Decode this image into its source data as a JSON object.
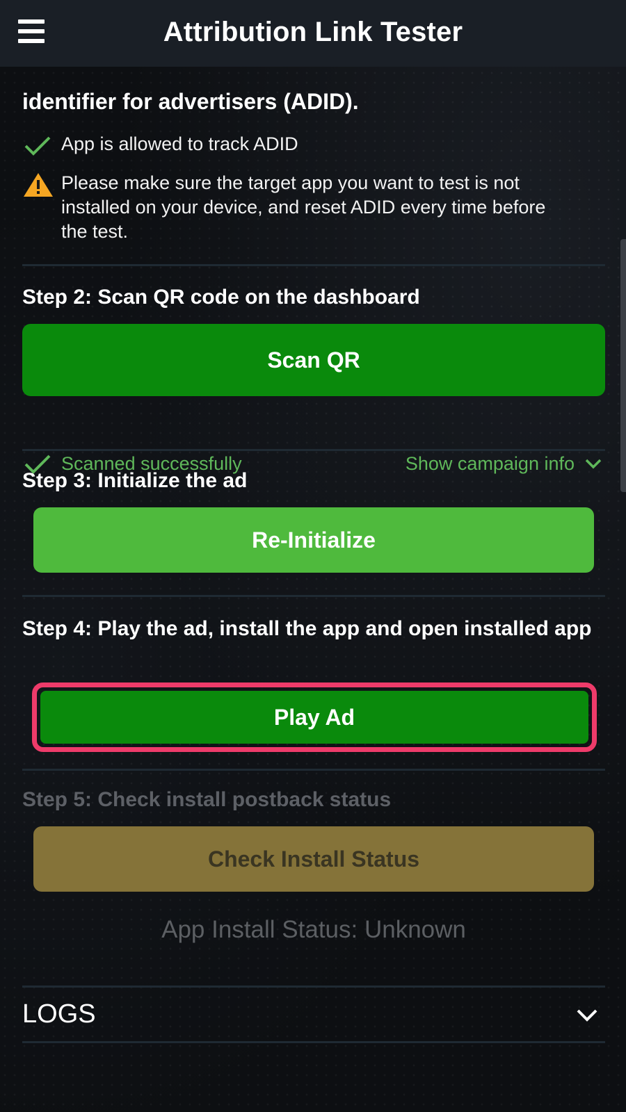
{
  "app_bar": {
    "title": "Attribution Link Tester",
    "menu_icon": "hamburger-menu-icon"
  },
  "intro": {
    "title": "identifier for advertisers (ADID).",
    "items": [
      {
        "icon": "check-icon",
        "text": "App is allowed to track ADID"
      },
      {
        "icon": "warning-icon",
        "text": "Please make sure the target app you want to test is not installed on your device, and reset ADID every time before the test."
      }
    ]
  },
  "step2": {
    "title": "Step 2: Scan QR code on the dashboard",
    "button_label": "Scan QR",
    "status_text": "Scanned successfully",
    "toggle_label": "Show campaign info"
  },
  "step3": {
    "title": "Step 3: Initialize the ad",
    "button_label": "Re-Initialize"
  },
  "step4": {
    "title": "Step 4: Play the ad, install the app and open installed app",
    "button_label": "Play Ad"
  },
  "step5": {
    "title": "Step 5: Check install postback status",
    "button_label": "Check Install Status",
    "install_status": "App Install Status: Unknown"
  },
  "logs": {
    "title": "LOGS"
  },
  "colors": {
    "primary_green": "#0a8a0c",
    "light_green": "#4fba3d",
    "success_text": "#5fb85a",
    "highlight": "#ee3b6a",
    "disabled_olive": "#857339",
    "warning": "#f5a623"
  }
}
